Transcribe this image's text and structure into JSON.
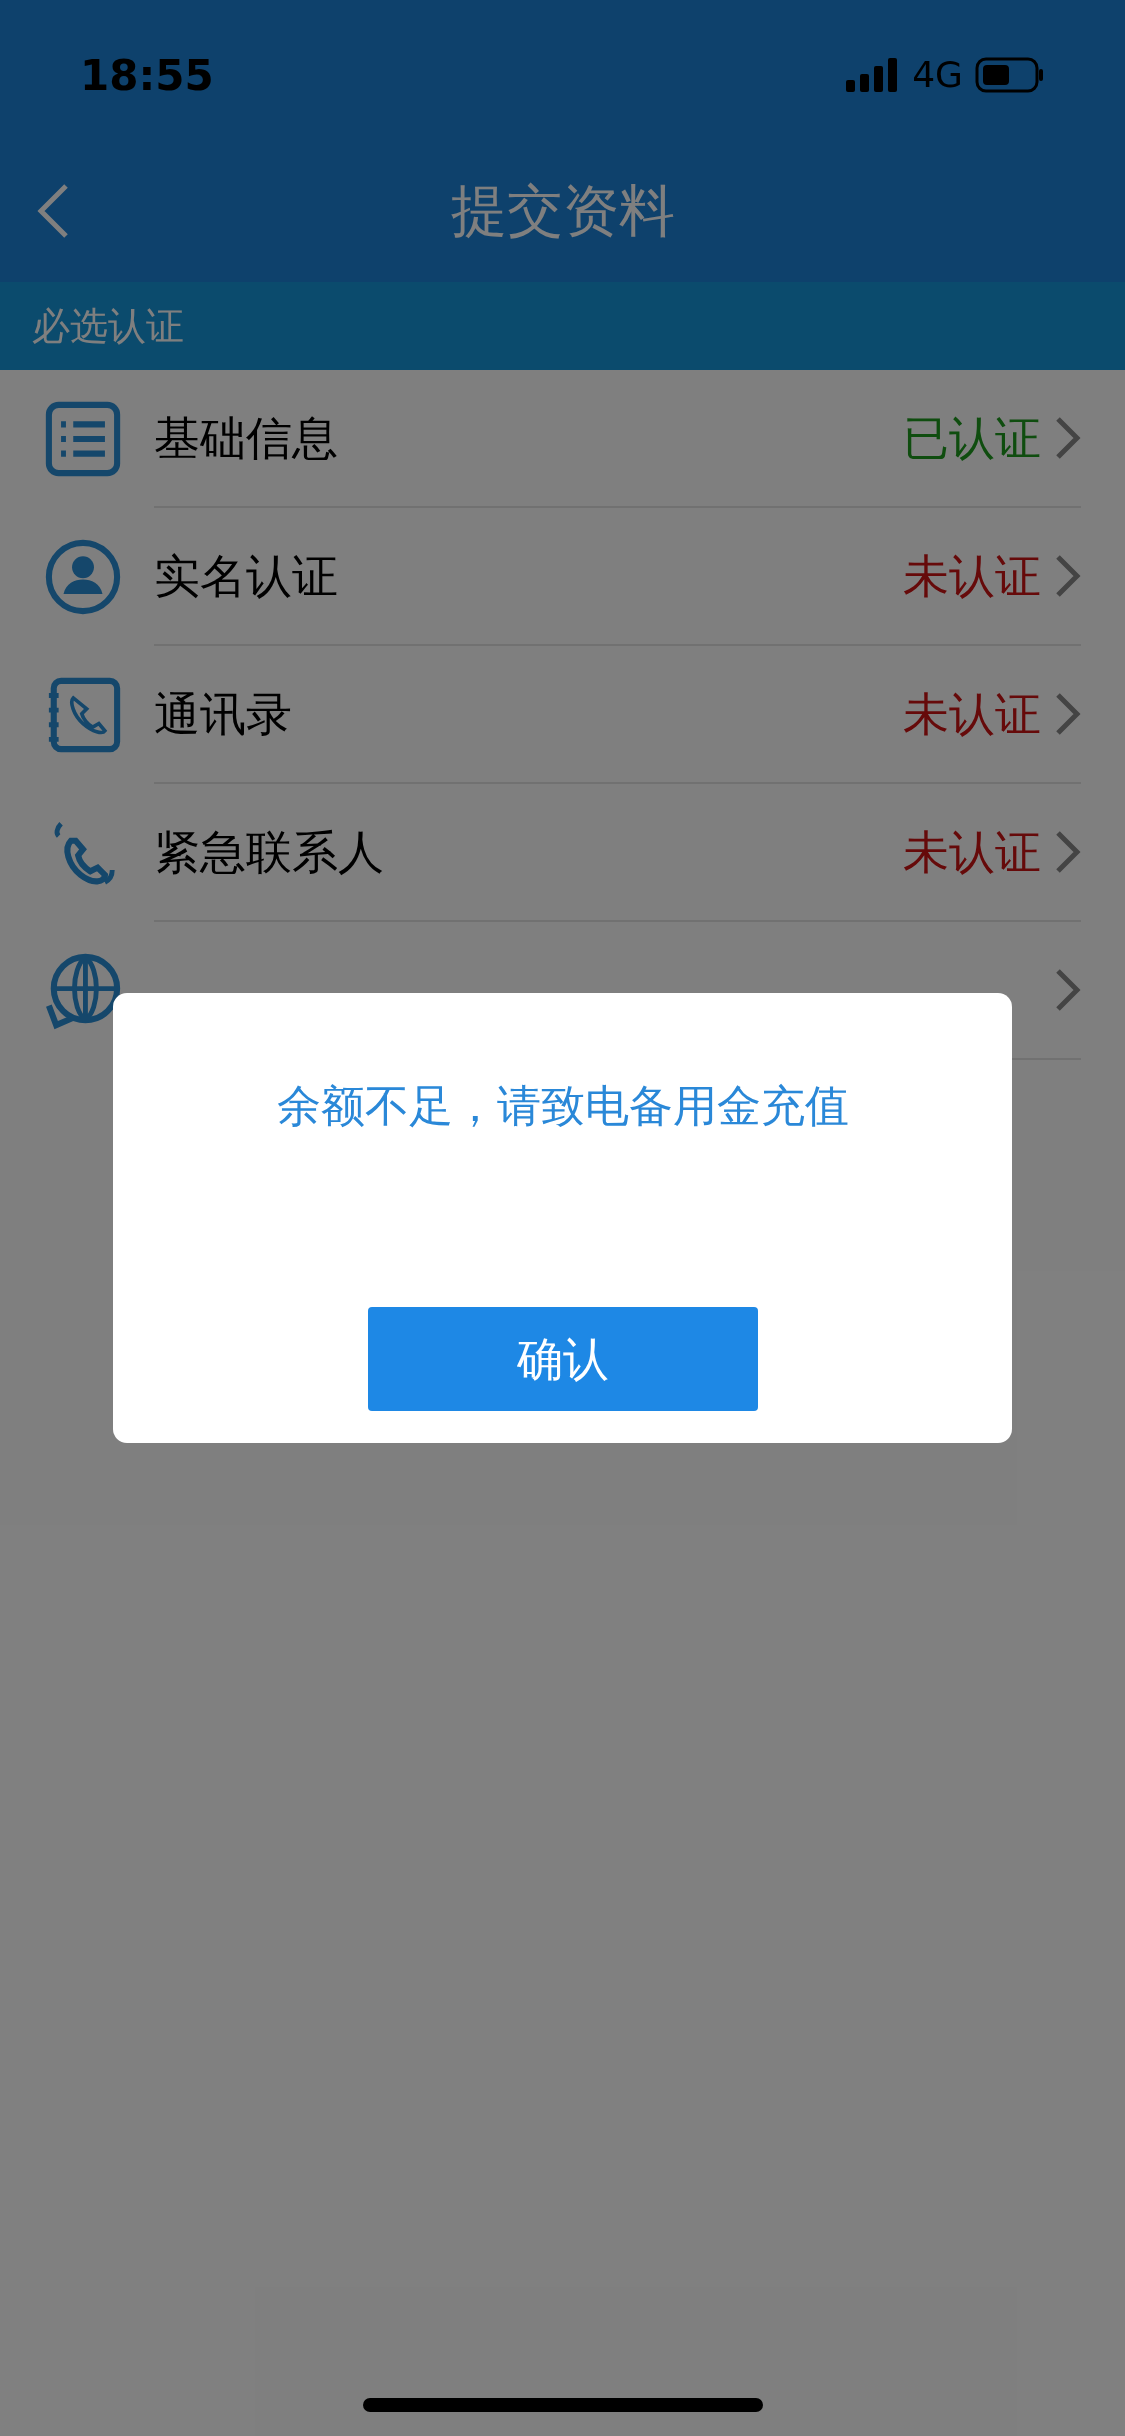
{
  "status_bar": {
    "time": "18:55",
    "network": "4G"
  },
  "nav": {
    "title": "提交资料"
  },
  "section": {
    "title": "必选认证"
  },
  "items": [
    {
      "label": "基础信息",
      "status": "已认证",
      "verified": true
    },
    {
      "label": "实名认证",
      "status": "未认证",
      "verified": false
    },
    {
      "label": "通讯录",
      "status": "未认证",
      "verified": false
    },
    {
      "label": "紧急联系人",
      "status": "未认证",
      "verified": false
    },
    {
      "covered": true
    }
  ],
  "dialog": {
    "message": "余额不足，请致电备用金充值",
    "button": "确认"
  }
}
